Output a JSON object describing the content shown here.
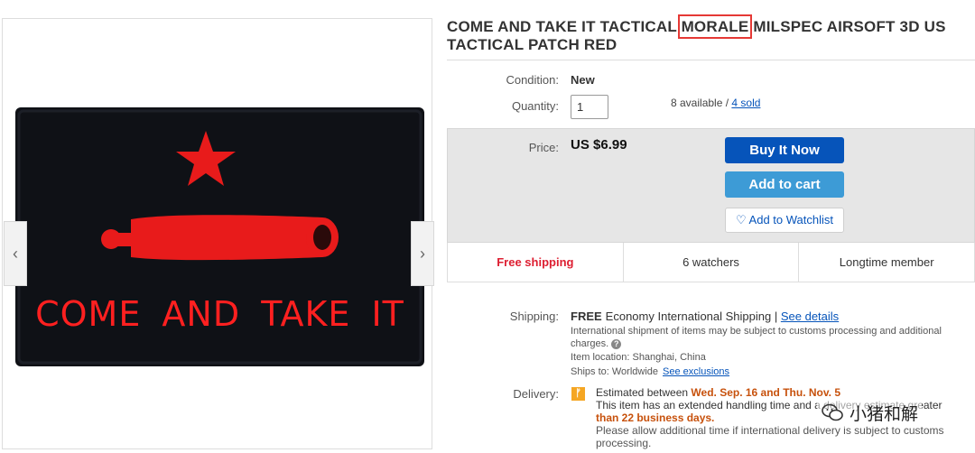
{
  "gallery": {
    "patch_text": "COME AND TAKE IT",
    "colors": {
      "patch_bg": "#0f1116",
      "embroidery_red": "#ff2020"
    },
    "prev_icon": "chevron-left-icon",
    "next_icon": "chevron-right-icon",
    "prev_glyph": "‹",
    "next_glyph": "›"
  },
  "listing": {
    "title_before": "COME AND TAKE IT TACTICAL ",
    "title_highlight": "MORALE",
    "title_after": " MILSPEC AIRSOFT 3D US TACTICAL PATCH RED",
    "highlight_color": "#e53935"
  },
  "condition": {
    "label": "Condition:",
    "value": "New"
  },
  "quantity": {
    "label": "Quantity:",
    "value": "1",
    "available_text": "8 available / ",
    "sold_link": "4 sold"
  },
  "price": {
    "label": "Price:",
    "value": "US $6.99",
    "buy_now": "Buy It Now",
    "add_to_cart": "Add to cart",
    "watchlist": "Add to Watchlist",
    "watchlist_icon": "heart-icon",
    "colors": {
      "buy": "#0654ba",
      "cart": "#3d9bd6"
    }
  },
  "badges": {
    "free_shipping": "Free shipping",
    "watchers": "6 watchers",
    "member": "Longtime member"
  },
  "shipping": {
    "label": "Shipping:",
    "free": "FREE",
    "method": "Economy International Shipping | ",
    "details_link": "See details",
    "note": "International shipment of items may be subject to customs processing and additional charges.",
    "info_icon": "question-icon",
    "location": "Item location:  Shanghai, China",
    "ships_to": "Ships to:  Worldwide",
    "exclusions_link": "See exclusions"
  },
  "delivery": {
    "label": "Delivery:",
    "flag_icon": "flag-icon",
    "estimated_prefix": "Estimated between ",
    "estimated_dates": "Wed. Sep. 16 and Thu. Nov. 5",
    "extended_prefix": "This item has an extended handling time and a delivery estimate greater",
    "extended_em": "than 22 business days.",
    "allow_note": "Please allow additional time if international delivery is subject to customs processing."
  },
  "watermark": {
    "text": "小猪和解",
    "icon": "wechat-logo-icon"
  }
}
